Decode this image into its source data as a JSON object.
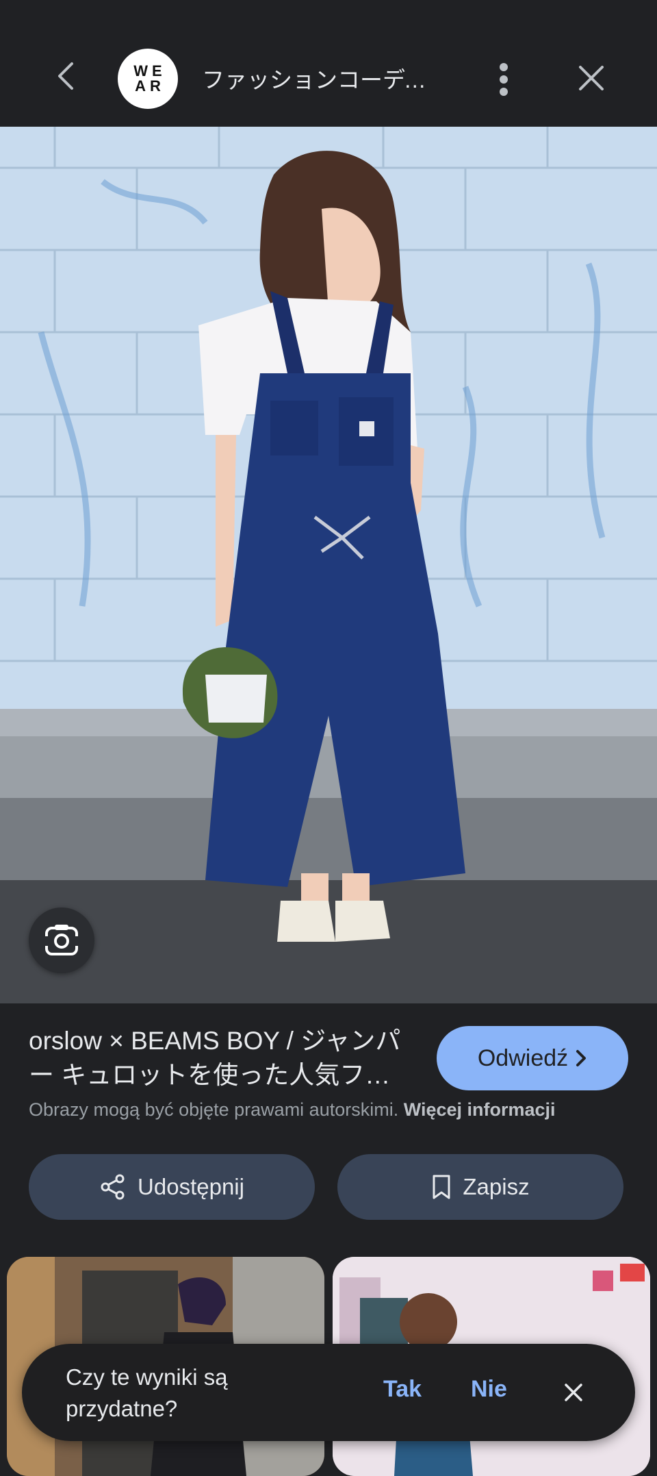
{
  "header": {
    "site_logo_text": "WE AR",
    "site_title": "ファッションコーディ…"
  },
  "result": {
    "title": "orslow × BEAMS BOY / ジャンパー キュロットを使った人気フ…",
    "visit_label": "Odwiedź",
    "copyright_text": "Obrazy mogą być objęte prawami autorskimi.",
    "more_info_label": "Więcej informacji"
  },
  "actions": {
    "share_label": "Udostępnij",
    "save_label": "Zapisz"
  },
  "feedback": {
    "question": "Czy te wyniki są przydatne?",
    "yes_label": "Tak",
    "no_label": "Nie"
  },
  "colors": {
    "background": "#202124",
    "accent": "#8ab4f8",
    "pill": "#394457"
  },
  "icons": [
    "back-arrow-icon",
    "more-vert-icon",
    "close-icon",
    "lens-icon",
    "share-icon",
    "bookmark-icon",
    "chevron-right-icon"
  ]
}
